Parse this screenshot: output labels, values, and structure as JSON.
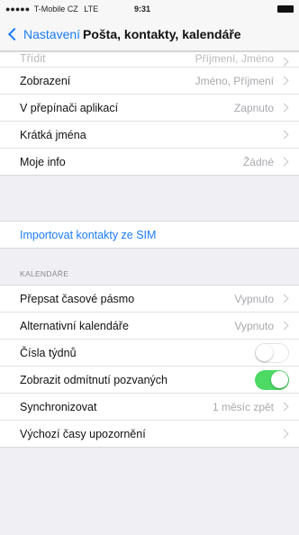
{
  "status_bar": {
    "signal": "●●●●●",
    "carrier": "T-Mobile CZ",
    "network": "LTE",
    "time": "9:31"
  },
  "nav": {
    "back_label": "Nastavení",
    "title": "Pošta, kontakty, kalendáře"
  },
  "partial_row": {
    "label": "Třídit",
    "value": "Příjmení, Jméno"
  },
  "contacts_rows": [
    {
      "label": "Zobrazení",
      "value": "Jméno, Příjmení"
    },
    {
      "label": "V přepínači aplikací",
      "value": "Zapnuto"
    },
    {
      "label": "Krátká jména",
      "value": ""
    },
    {
      "label": "Moje info",
      "value": "Žádné"
    }
  ],
  "import_sim_label": "Importovat kontakty ze SIM",
  "calendar_header": "KALENDÁŘE",
  "calendar_rows": {
    "timezone": {
      "label": "Přepsat časové pásmo",
      "value": "Vypnuto"
    },
    "alt_calendars": {
      "label": "Alternativní kalendáře",
      "value": "Vypnuto"
    },
    "week_numbers": {
      "label": "Čísla týdnů",
      "toggle": "off"
    },
    "declined": {
      "label": "Zobrazit odmítnutí pozvaných",
      "toggle": "on"
    },
    "sync": {
      "label": "Synchronizovat",
      "value": "1 měsíc zpět"
    },
    "alert_times": {
      "label": "Výchozí časy upozornění",
      "value": ""
    }
  },
  "colors": {
    "accent": "#1a7cf6",
    "toggle_on": "#4cd964",
    "background": "#efeff4"
  }
}
